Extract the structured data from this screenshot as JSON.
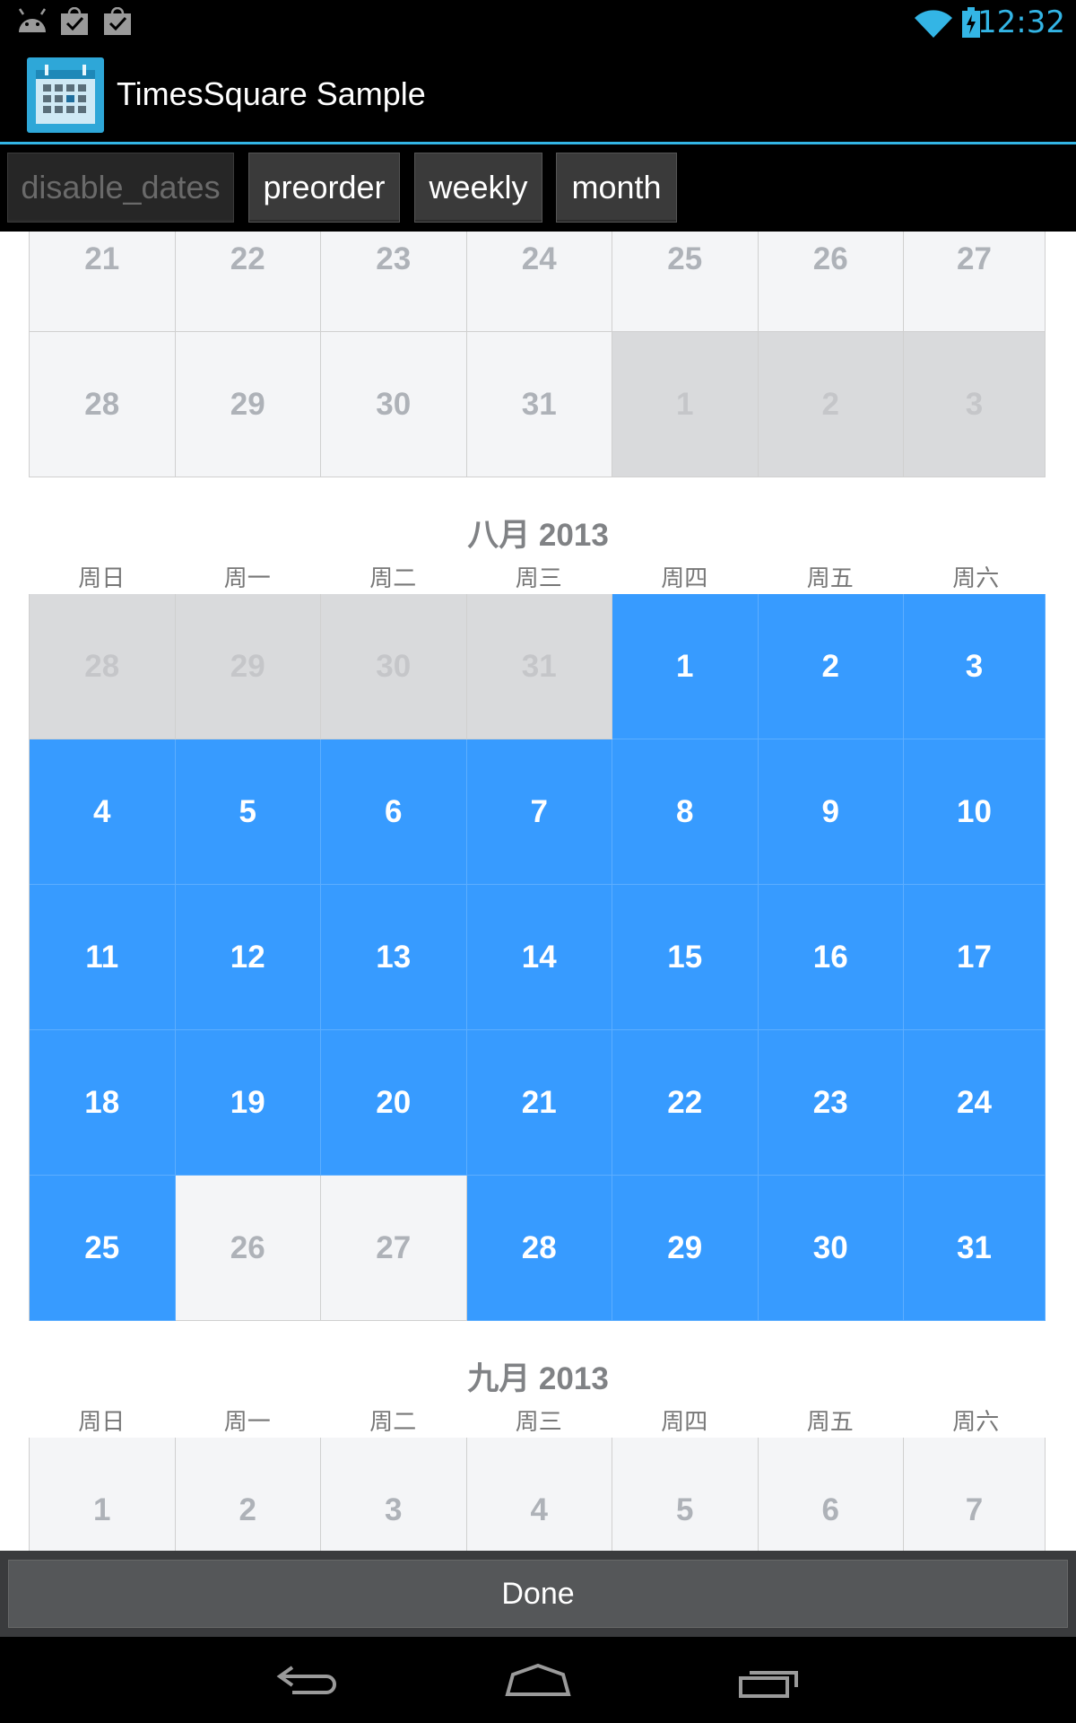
{
  "status_bar": {
    "time": "12:32",
    "icons": [
      "android-icon",
      "shopping-bag-check-icon",
      "shopping-bag-check-icon",
      "wifi-icon",
      "battery-charging-icon"
    ],
    "accent_color": "#33b5e5"
  },
  "action_bar": {
    "title": "TimesSquare Sample",
    "icon": "calendar-app-icon"
  },
  "tabs": [
    {
      "label": "disable_dates",
      "enabled": false
    },
    {
      "label": "preorder",
      "enabled": true
    },
    {
      "label": "weekly",
      "enabled": true
    },
    {
      "label": "month",
      "enabled": true
    }
  ],
  "calendar": {
    "selected_color": "#379bff",
    "weekdays": [
      "周日",
      "周一",
      "周二",
      "周三",
      "周四",
      "周五",
      "周六"
    ],
    "months": [
      {
        "title": "",
        "weeks": [
          [
            {
              "d": "21",
              "s": "cur"
            },
            {
              "d": "22",
              "s": "cur"
            },
            {
              "d": "23",
              "s": "cur"
            },
            {
              "d": "24",
              "s": "cur"
            },
            {
              "d": "25",
              "s": "cur"
            },
            {
              "d": "26",
              "s": "cur"
            },
            {
              "d": "27",
              "s": "cur"
            }
          ],
          [
            {
              "d": "28",
              "s": "cur"
            },
            {
              "d": "29",
              "s": "cur"
            },
            {
              "d": "30",
              "s": "cur"
            },
            {
              "d": "31",
              "s": "cur"
            },
            {
              "d": "1",
              "s": "other"
            },
            {
              "d": "2",
              "s": "other"
            },
            {
              "d": "3",
              "s": "other"
            }
          ]
        ]
      },
      {
        "title": "八月 2013",
        "weeks": [
          [
            {
              "d": "28",
              "s": "other"
            },
            {
              "d": "29",
              "s": "other"
            },
            {
              "d": "30",
              "s": "other"
            },
            {
              "d": "31",
              "s": "other"
            },
            {
              "d": "1",
              "s": "sel"
            },
            {
              "d": "2",
              "s": "sel"
            },
            {
              "d": "3",
              "s": "sel"
            }
          ],
          [
            {
              "d": "4",
              "s": "sel"
            },
            {
              "d": "5",
              "s": "sel"
            },
            {
              "d": "6",
              "s": "sel"
            },
            {
              "d": "7",
              "s": "sel"
            },
            {
              "d": "8",
              "s": "sel"
            },
            {
              "d": "9",
              "s": "sel"
            },
            {
              "d": "10",
              "s": "sel"
            }
          ],
          [
            {
              "d": "11",
              "s": "sel"
            },
            {
              "d": "12",
              "s": "sel"
            },
            {
              "d": "13",
              "s": "sel"
            },
            {
              "d": "14",
              "s": "sel"
            },
            {
              "d": "15",
              "s": "sel"
            },
            {
              "d": "16",
              "s": "sel"
            },
            {
              "d": "17",
              "s": "sel"
            }
          ],
          [
            {
              "d": "18",
              "s": "sel"
            },
            {
              "d": "19",
              "s": "sel"
            },
            {
              "d": "20",
              "s": "sel"
            },
            {
              "d": "21",
              "s": "sel"
            },
            {
              "d": "22",
              "s": "sel"
            },
            {
              "d": "23",
              "s": "sel"
            },
            {
              "d": "24",
              "s": "sel"
            }
          ],
          [
            {
              "d": "25",
              "s": "sel"
            },
            {
              "d": "26",
              "s": "cur"
            },
            {
              "d": "27",
              "s": "cur"
            },
            {
              "d": "28",
              "s": "sel"
            },
            {
              "d": "29",
              "s": "sel"
            },
            {
              "d": "30",
              "s": "sel"
            },
            {
              "d": "31",
              "s": "sel"
            }
          ]
        ]
      },
      {
        "title": "九月 2013",
        "weeks": [
          [
            {
              "d": "1",
              "s": "cur"
            },
            {
              "d": "2",
              "s": "cur"
            },
            {
              "d": "3",
              "s": "cur"
            },
            {
              "d": "4",
              "s": "cur"
            },
            {
              "d": "5",
              "s": "cur"
            },
            {
              "d": "6",
              "s": "cur"
            },
            {
              "d": "7",
              "s": "cur"
            }
          ]
        ]
      }
    ]
  },
  "done_label": "Done",
  "nav_bar": {
    "icons": [
      "back-icon",
      "home-icon",
      "recent-apps-icon"
    ]
  }
}
